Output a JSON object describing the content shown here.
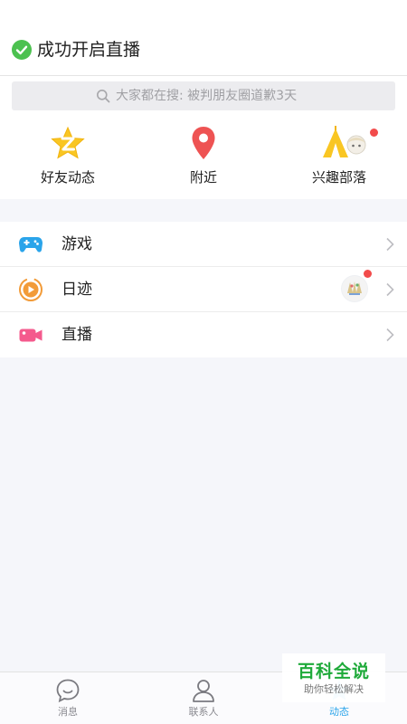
{
  "toast": {
    "text": "成功开启直播",
    "icon": "check-circle-icon",
    "color": "#4cc150"
  },
  "search": {
    "placeholder": "大家都在搜: 被判朋友圈道歉3天",
    "icon": "search-icon"
  },
  "quick_actions": [
    {
      "label": "好友动态",
      "icon": "qzone-star-icon"
    },
    {
      "label": "附近",
      "icon": "location-pin-icon"
    },
    {
      "label": "兴趣部落",
      "icon": "tribe-tent-icon",
      "badge": true
    }
  ],
  "list_items": [
    {
      "label": "游戏",
      "icon": "gamepad-icon"
    },
    {
      "label": "日迹",
      "icon": "play-circle-icon",
      "avatar": true,
      "badge": true
    },
    {
      "label": "直播",
      "icon": "video-camera-icon"
    }
  ],
  "tabbar": {
    "items": [
      {
        "label": "消息",
        "icon": "chat-bubble-icon"
      },
      {
        "label": "联系人",
        "icon": "contact-person-icon"
      },
      {
        "label": "动态",
        "icon": "star-icon",
        "active": true
      }
    ]
  },
  "watermark": {
    "title": "百科全说",
    "subtitle": "助你轻松解决"
  },
  "colors": {
    "accent": "#2aa4ea",
    "badge": "#f24b4b",
    "game": "#2aa4ea",
    "diary": "#f29b38",
    "live": "#f45a8d"
  }
}
